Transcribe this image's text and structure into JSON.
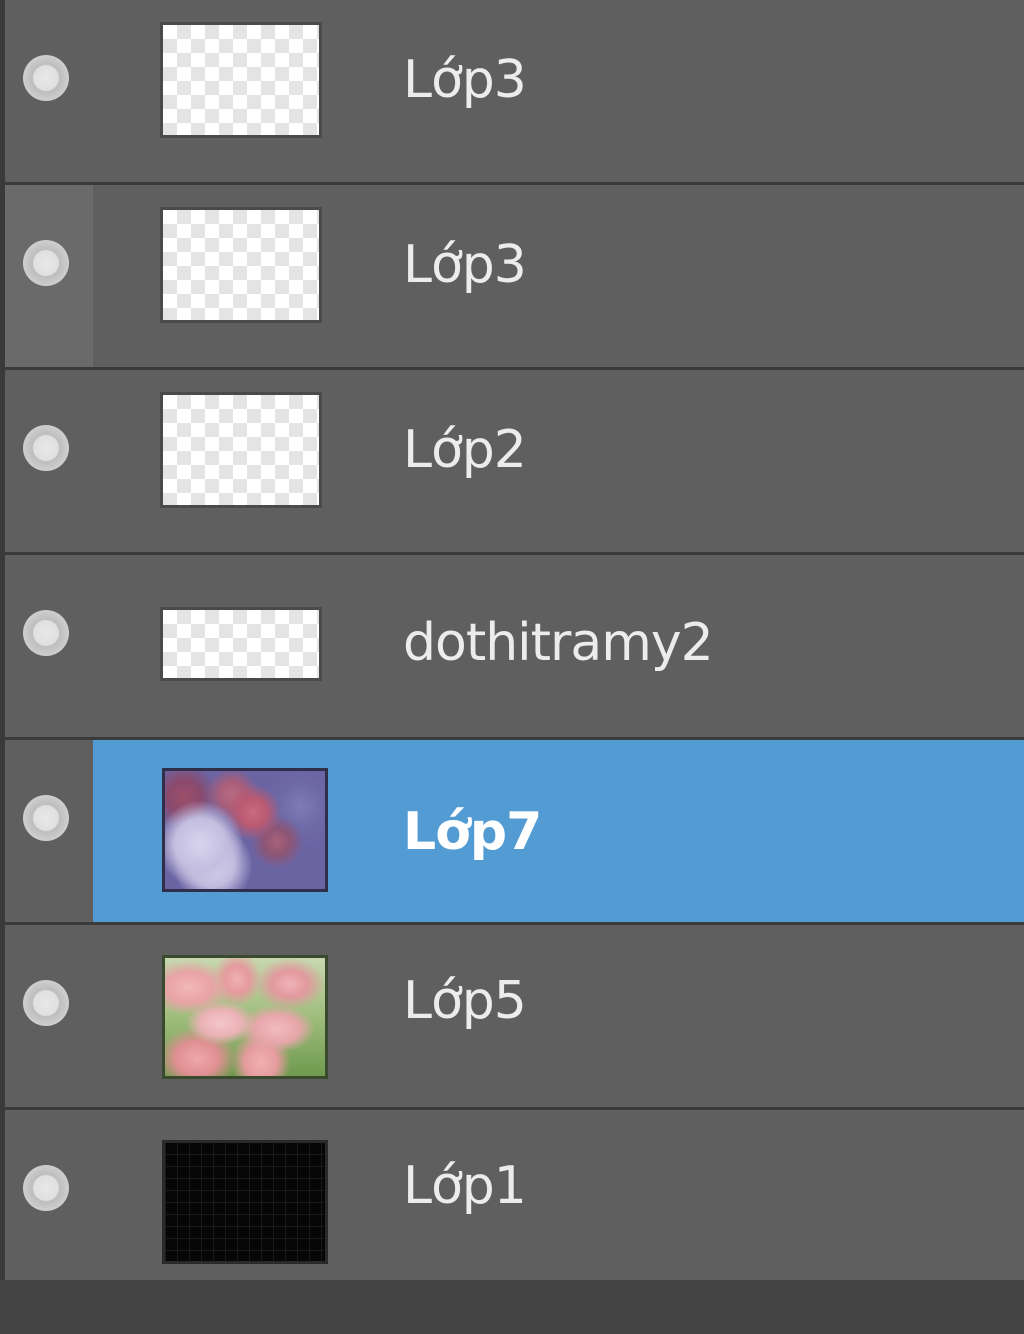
{
  "layers_panel": {
    "layers": [
      {
        "name": "Lớp3",
        "thumbnail": "transparent",
        "visible": true,
        "selected": false,
        "hovered": false
      },
      {
        "name": "Lớp3",
        "thumbnail": "transparent",
        "visible": true,
        "selected": false,
        "hovered": true
      },
      {
        "name": "Lớp2",
        "thumbnail": "transparent",
        "visible": true,
        "selected": false,
        "hovered": false
      },
      {
        "name": "dothitramy2",
        "thumbnail": "transparent-wide",
        "visible": true,
        "selected": false,
        "hovered": false
      },
      {
        "name": "Lớp7",
        "thumbnail": "hydrangea-photo",
        "visible": true,
        "selected": true,
        "hovered": false
      },
      {
        "name": "Lớp5",
        "thumbnail": "tulips-photo",
        "visible": true,
        "selected": false,
        "hovered": false
      },
      {
        "name": "Lớp1",
        "thumbnail": "black-fill",
        "visible": true,
        "selected": false,
        "hovered": false
      }
    ],
    "colors": {
      "panel_background": "#444444",
      "row_background": "#5f5f5f",
      "selected_background": "#529cd3",
      "text": "#ececec"
    }
  }
}
